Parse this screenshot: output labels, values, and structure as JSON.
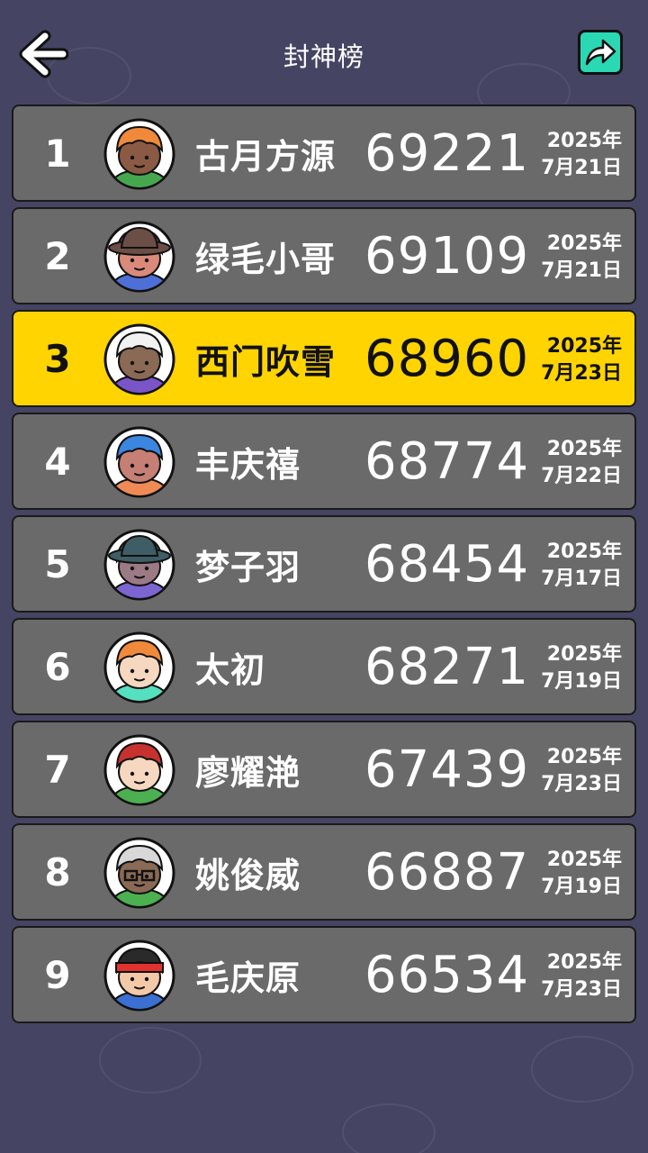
{
  "header": {
    "title": "封神榜",
    "back_icon": "arrow-left-icon",
    "share_icon": "share-arrow-icon",
    "share_color": "#2ad8b3"
  },
  "colors": {
    "background": "#454462",
    "row": "#6a6a6a",
    "highlight": "#ffd400"
  },
  "leaderboard": [
    {
      "rank": "1",
      "name": "古月方源",
      "score": "69221",
      "year": "2025年",
      "day": "7月21日",
      "avatar": "orange-hair-monkey-avatar",
      "highlight": false
    },
    {
      "rank": "2",
      "name": "绿毛小哥",
      "score": "69109",
      "year": "2025年",
      "day": "7月21日",
      "avatar": "brown-hat-avatar",
      "highlight": false
    },
    {
      "rank": "3",
      "name": "西门吹雪",
      "score": "68960",
      "year": "2025年",
      "day": "7月23日",
      "avatar": "white-hair-avatar",
      "highlight": true
    },
    {
      "rank": "4",
      "name": "丰庆禧",
      "score": "68774",
      "year": "2025年",
      "day": "7月22日",
      "avatar": "blue-hair-avatar",
      "highlight": false
    },
    {
      "rank": "5",
      "name": "梦子羽",
      "score": "68454",
      "year": "2025年",
      "day": "7月17日",
      "avatar": "teal-hat-avatar",
      "highlight": false
    },
    {
      "rank": "6",
      "name": "太初",
      "score": "68271",
      "year": "2025年",
      "day": "7月19日",
      "avatar": "smiling-orange-hair-avatar",
      "highlight": false
    },
    {
      "rank": "7",
      "name": "廖耀滟",
      "score": "67439",
      "year": "2025年",
      "day": "7月23日",
      "avatar": "red-hair-avatar",
      "highlight": false
    },
    {
      "rank": "8",
      "name": "姚俊威",
      "score": "66887",
      "year": "2025年",
      "day": "7月19日",
      "avatar": "glasses-avatar",
      "highlight": false
    },
    {
      "rank": "9",
      "name": "毛庆原",
      "score": "66534",
      "year": "2025年",
      "day": "7月23日",
      "avatar": "red-headband-avatar",
      "highlight": false
    }
  ]
}
